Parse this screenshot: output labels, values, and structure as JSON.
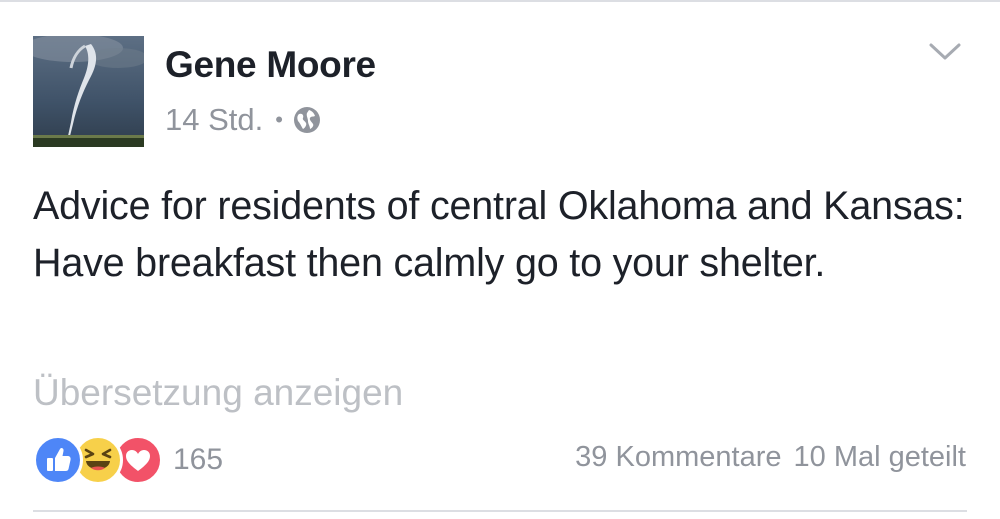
{
  "post": {
    "author": "Gene Moore",
    "timestamp": "14 Std.",
    "separator": "•",
    "privacy_icon": "globe-icon",
    "menu_icon": "chevron-down-icon",
    "avatar": "tornado-photo",
    "text": "Advice for residents of central Oklahoma and Kansas:  Have breakfast then calmly go to your shelter.",
    "translate_link": "Übersetzung anzeigen"
  },
  "footer": {
    "reactions": [
      "like-icon",
      "haha-icon",
      "love-icon"
    ],
    "reaction_count": "165",
    "comments": "39 Kommentare",
    "shares": "10 Mal geteilt"
  },
  "colors": {
    "text": "#1d2129",
    "meta": "#90949c",
    "link_faded": "#bdc0c5",
    "like": "#4e86f7",
    "haha": "#f7d04a",
    "love": "#f25268"
  }
}
